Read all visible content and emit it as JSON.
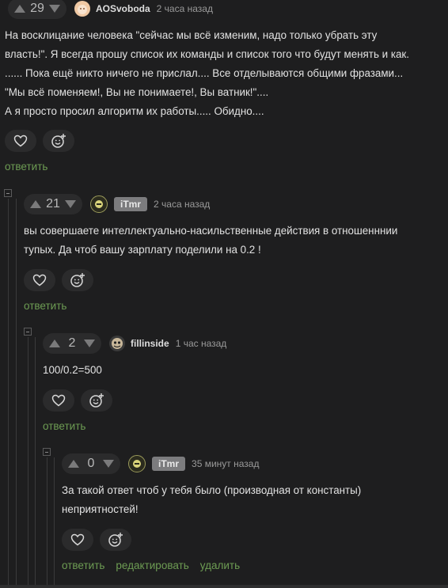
{
  "comments": [
    {
      "rating": "29",
      "username": "AOSvoboda",
      "author_badge": "",
      "time": "2 часа назад",
      "text": "На восклицание человека \"сейчас мы всё изменим, надо только убрать эту\nвласть!\". Я всегда прошу список их команды и список того что будут менять и как.\n...... Пока ещё никто ничего не прислал.... Все отделываются общими фразами...\n\"Мы всё поменяем!, Вы не понимаете!, Вы ватник!\"....\nА я просто просил алгоритм их работы..... Обидно....",
      "links": [
        "ответить"
      ]
    },
    {
      "rating": "21",
      "username": "",
      "author_badge": "iTmr",
      "time": "2 часа назад",
      "text": "вы совершаете интеллектуально-насильственные действия в отношенннии\nтупых. Да чтоб вашу зарплату поделили на 0.2 !",
      "links": [
        "ответить"
      ]
    },
    {
      "rating": "2",
      "username": "fillinside",
      "author_badge": "",
      "time": "1 час назад",
      "text": "100/0.2=500",
      "links": [
        "ответить"
      ]
    },
    {
      "rating": "0",
      "username": "",
      "author_badge": "iTmr",
      "time": "35 минут назад",
      "text": "За такой ответ чтоб у тебя было (производная от константы)\nнеприятностей!",
      "links": [
        "ответить",
        "редактировать",
        "удалить"
      ]
    }
  ],
  "icons": {
    "upvote": "triangle-up-icon",
    "downvote": "triangle-down-icon",
    "like": "heart-icon",
    "reaction": "smiley-plus-icon",
    "collapse": "collapse-minus-icon"
  },
  "colors": {
    "background": "#1e1e1f",
    "link": "#6d9c53",
    "badge": "#7c7c7e"
  }
}
